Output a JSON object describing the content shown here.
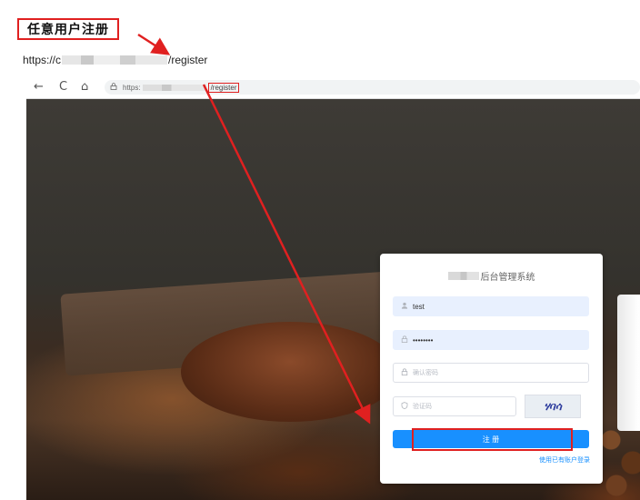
{
  "annotation": {
    "title": "任意用户注册",
    "url_prefix": "https://c",
    "url_suffix": "/register"
  },
  "browser": {
    "back_icon": "←",
    "reload_icon": "C",
    "home_icon": "⌂",
    "lock_icon": "🔒",
    "address_prefix": "https:",
    "address_path": "/register"
  },
  "form": {
    "title": "后台管理系统",
    "username": {
      "value": "test",
      "icon": "user-icon"
    },
    "password": {
      "value": "••••••••",
      "icon": "lock-icon"
    },
    "confirm_password": {
      "placeholder": "确认密码",
      "icon": "lock-icon"
    },
    "captcha": {
      "placeholder": "验证码",
      "icon": "shield-icon",
      "image_text": "ሃባሳ"
    },
    "register_button": "注 册",
    "login_link": "使用已有账户登录"
  },
  "colors": {
    "annotation_red": "#e02020",
    "primary_blue": "#1890ff"
  }
}
